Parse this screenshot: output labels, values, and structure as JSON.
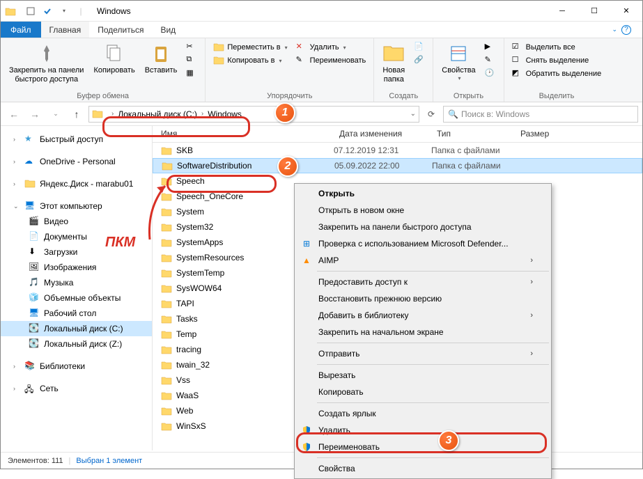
{
  "window": {
    "title": "Windows"
  },
  "menu": {
    "file": "Файл",
    "home": "Главная",
    "share": "Поделиться",
    "view": "Вид"
  },
  "ribbon": {
    "clipboard": {
      "label": "Буфер обмена",
      "pin": "Закрепить на панели\nбыстрого доступа",
      "copy": "Копировать",
      "paste": "Вставить"
    },
    "organize": {
      "label": "Упорядочить",
      "move": "Переместить в",
      "copy_to": "Копировать в",
      "delete": "Удалить",
      "rename": "Переименовать"
    },
    "new": {
      "label": "Создать",
      "folder": "Новая\nпапка"
    },
    "open": {
      "label": "Открыть",
      "props": "Свойства"
    },
    "select": {
      "label": "Выделить",
      "all": "Выделить все",
      "none": "Снять выделение",
      "invert": "Обратить выделение"
    }
  },
  "address": {
    "seg1": "Локальный диск (C:)",
    "seg2": "Windows"
  },
  "search": {
    "placeholder": "Поиск в: Windows"
  },
  "sidebar": {
    "quick": "Быстрый доступ",
    "onedrive": "OneDrive - Personal",
    "yandex": "Яндекс.Диск - marabu01",
    "thispc": "Этот компьютер",
    "video": "Видео",
    "docs": "Документы",
    "downloads": "Загрузки",
    "pictures": "Изображения",
    "music": "Музыка",
    "objects3d": "Объемные объекты",
    "desktop": "Рабочий стол",
    "diskc": "Локальный диск (C:)",
    "diskz": "Локальный диск (Z:)",
    "libs": "Библиотеки",
    "network": "Сеть"
  },
  "columns": {
    "name": "Имя",
    "date": "Дата изменения",
    "type": "Тип",
    "size": "Размер"
  },
  "files": [
    {
      "name": "SKB",
      "date": "07.12.2019 12:31",
      "type": "Папка с файлами"
    },
    {
      "name": "SoftwareDistribution",
      "date": "05.09.2022 22:00",
      "type": "Папка с файлами",
      "selected": true
    },
    {
      "name": "Speech",
      "date": "",
      "type": ""
    },
    {
      "name": "Speech_OneCore",
      "date": "",
      "type": ""
    },
    {
      "name": "System",
      "date": "",
      "type": ""
    },
    {
      "name": "System32",
      "date": "",
      "type": ""
    },
    {
      "name": "SystemApps",
      "date": "",
      "type": ""
    },
    {
      "name": "SystemResources",
      "date": "",
      "type": ""
    },
    {
      "name": "SystemTemp",
      "date": "",
      "type": ""
    },
    {
      "name": "SysWOW64",
      "date": "",
      "type": ""
    },
    {
      "name": "TAPI",
      "date": "",
      "type": ""
    },
    {
      "name": "Tasks",
      "date": "",
      "type": ""
    },
    {
      "name": "Temp",
      "date": "",
      "type": ""
    },
    {
      "name": "tracing",
      "date": "",
      "type": ""
    },
    {
      "name": "twain_32",
      "date": "",
      "type": ""
    },
    {
      "name": "Vss",
      "date": "",
      "type": ""
    },
    {
      "name": "WaaS",
      "date": "",
      "type": ""
    },
    {
      "name": "Web",
      "date": "",
      "type": ""
    },
    {
      "name": "WinSxS",
      "date": "",
      "type": ""
    }
  ],
  "context": {
    "open": "Открыть",
    "open_new": "Открыть в новом окне",
    "pin_quick": "Закрепить на панели быстрого доступа",
    "defender": "Проверка с использованием Microsoft Defender...",
    "aimp": "AIMP",
    "share": "Предоставить доступ к",
    "restore": "Восстановить прежнюю версию",
    "library": "Добавить в библиотеку",
    "pin_start": "Закрепить на начальном экране",
    "send": "Отправить",
    "cut": "Вырезать",
    "copy": "Копировать",
    "shortcut": "Создать ярлык",
    "delete": "Удалить",
    "rename": "Переименовать",
    "props": "Свойства"
  },
  "status": {
    "items": "Элементов: 111",
    "selected": "Выбран 1 элемент"
  },
  "annotation": {
    "pkm": "ПКМ"
  }
}
